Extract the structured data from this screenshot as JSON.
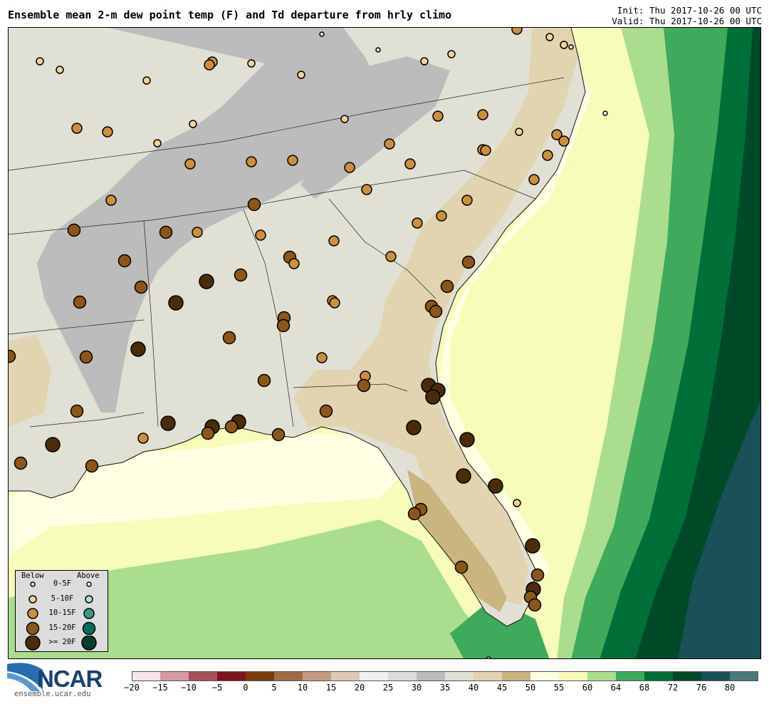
{
  "header": {
    "title": "Ensemble mean 2-m dew point temp (F) and Td departure from hrly climo",
    "init": "Init: Thu 2017-10-26 00 UTC",
    "valid": "Valid: Thu 2017-10-26 00 UTC"
  },
  "legend": {
    "below_label": "Below",
    "above_label": "Above",
    "rows": [
      {
        "label": "0-5F",
        "below_color": "#f5e6c8",
        "above_color": "#ffffff"
      },
      {
        "label": "5-10F",
        "below_color": "#f2d29a",
        "above_color": "#a8e0d8"
      },
      {
        "label": "10-15F",
        "below_color": "#cc8f40",
        "above_color": "#3a9a8a"
      },
      {
        "label": "15-20F",
        "below_color": "#8c5618",
        "above_color": "#0a6e5a"
      },
      {
        "label": ">= 20F",
        "below_color": "#4a2c0a",
        "above_color": "#063d30"
      }
    ]
  },
  "colorbar": {
    "ticks": [
      "−20",
      "−15",
      "−10",
      "−5",
      "0",
      "5",
      "10",
      "15",
      "20",
      "25",
      "30",
      "35",
      "40",
      "45",
      "50",
      "55",
      "60",
      "64",
      "68",
      "72",
      "76",
      "80"
    ],
    "colors": [
      "#f7e4ea",
      "#d49aa4",
      "#a85058",
      "#7f1420",
      "#7a3c0c",
      "#a06c48",
      "#c49a80",
      "#e0c8b8",
      "#f0f0f0",
      "#dcdcdc",
      "#bcbcbc",
      "#e0e0d4",
      "#e2d4b0",
      "#cab480",
      "#fefee2",
      "#f8fcba",
      "#aade8e",
      "#40aa5c",
      "#007038",
      "#004a2a",
      "#1a5058",
      "#4a7878"
    ]
  },
  "branding": {
    "logo_text": "NCAR",
    "url": "ensemble.ucar.edu"
  },
  "map": {
    "region": "Southeastern United States",
    "field_colors": {
      "land_35_40": "#e0e0d4",
      "land_30_35": "#bcbcbc",
      "land_40_45": "#e2d4b0",
      "land_45_50": "#cab480",
      "sea_50_55": "#fefee2",
      "sea_55_60": "#f8fcba",
      "sea_60_64": "#aade8e",
      "sea_64_68": "#40aa5c",
      "sea_68_72": "#007038",
      "sea_72_76": "#004a2a",
      "sea_76_80": "#1a5058"
    }
  }
}
